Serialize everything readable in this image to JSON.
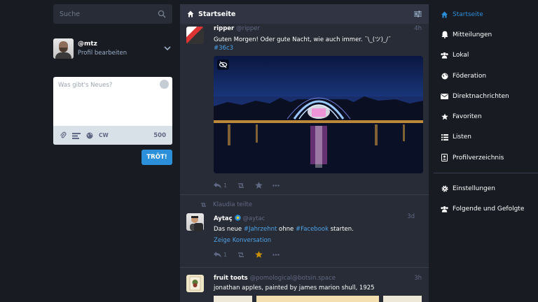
{
  "search": {
    "placeholder": "Suche"
  },
  "profile": {
    "handle": "@mtz",
    "edit": "Profil bearbeiten"
  },
  "compose": {
    "placeholder": "Was gibt's Neues?",
    "cw": "CW",
    "count": "500",
    "button": "TRÖT!"
  },
  "column": {
    "title": "Startseite"
  },
  "statuses": [
    {
      "name": "ripper",
      "acct": "@ripper",
      "time": "4h",
      "text": "Guten Morgen! Oder gute Nacht, wie auch immer. ¯\\_(ツ)_/¯",
      "hashtag": "#36c3",
      "replies": "1"
    },
    {
      "reblogged_by": "Klaudia teilte",
      "name": "Aytaç",
      "acct": "@aytac",
      "time": "3d",
      "text_a": "Das neue ",
      "link_a": "#Jahrzehnt",
      "text_b": " ohne ",
      "link_b": "#Facebook",
      "text_c": " starten.",
      "show_thread": "Zeige Konversation",
      "replies": "1"
    },
    {
      "name": "fruit toots",
      "acct": "@pomological@botsin.space",
      "time": "3h",
      "text": "jonathan apples, painted by james marion shull, 1925"
    }
  ],
  "nav": [
    {
      "label": "Startseite",
      "icon": "home-icon"
    },
    {
      "label": "Mitteilungen",
      "icon": "bell-icon"
    },
    {
      "label": "Lokal",
      "icon": "users-icon"
    },
    {
      "label": "Föderation",
      "icon": "globe-icon"
    },
    {
      "label": "Direktnachrichten",
      "icon": "envelope-icon"
    },
    {
      "label": "Favoriten",
      "icon": "star-icon"
    },
    {
      "label": "Listen",
      "icon": "list-icon"
    },
    {
      "label": "Profilverzeichnis",
      "icon": "address-book-icon"
    },
    {
      "label": "Einstellungen",
      "icon": "gear-icon"
    },
    {
      "label": "Folgende und Gefolgte",
      "icon": "users-icon"
    }
  ],
  "colors": {
    "accent": "#2b90d9",
    "background": "#191b22",
    "column": "#282c37",
    "favourite": "#ca8f04"
  }
}
